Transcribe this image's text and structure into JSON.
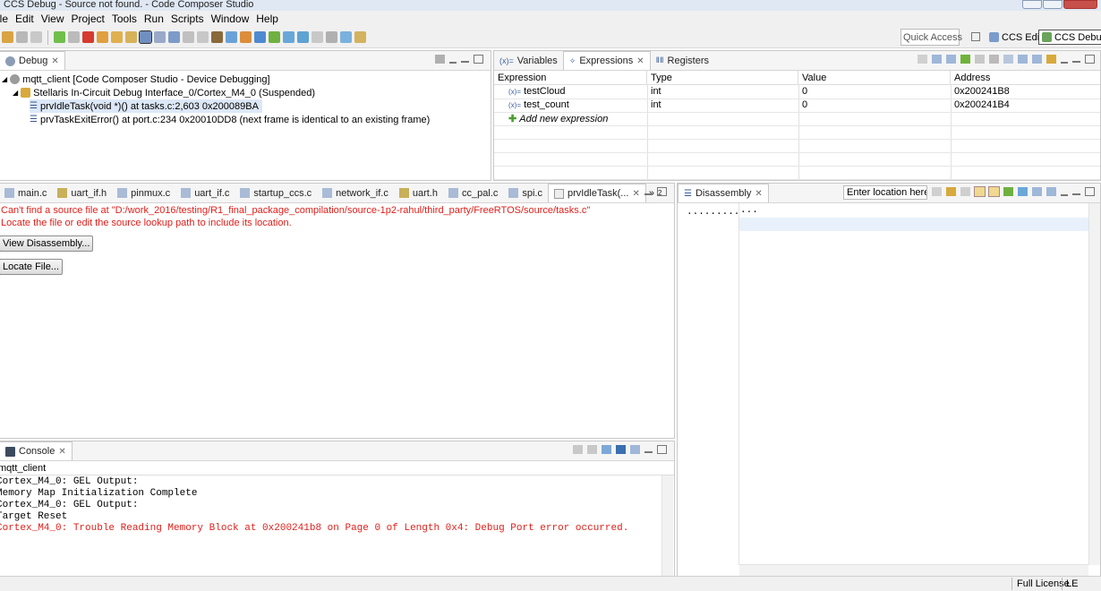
{
  "window": {
    "title": "CCS Debug - Source not found. - Code Composer Studio"
  },
  "menu": [
    "ile",
    "Edit",
    "View",
    "Project",
    "Tools",
    "Run",
    "Scripts",
    "Window",
    "Help"
  ],
  "toolbar": {
    "quick_access": "Quick Access",
    "perspectives": [
      {
        "label": "CCS Edit",
        "active": false
      },
      {
        "label": "CCS Debug",
        "active": true
      }
    ]
  },
  "debug_view": {
    "tab": "Debug",
    "tree": [
      {
        "label": "mqtt_client [Code Composer Studio - Device Debugging]",
        "icon": "debug-session-icon"
      },
      {
        "label": "Stellaris In-Circuit Debug Interface_0/Cortex_M4_0 (Suspended)",
        "icon": "thread-icon"
      },
      {
        "label": "prvIdleTask(void *)() at tasks.c:2,603 0x200089BA",
        "icon": "stack-frame-icon",
        "selected": true
      },
      {
        "label": "prvTaskExitError() at port.c:234 0x20010DD8  (next frame is identical to an existing frame)",
        "icon": "stack-frame-icon"
      }
    ]
  },
  "expressions_view": {
    "tabs": [
      "Variables",
      "Expressions",
      "Registers"
    ],
    "columns": [
      "Expression",
      "Type",
      "Value",
      "Address"
    ],
    "rows": [
      {
        "expression": "testCloud",
        "type": "int",
        "value": "0",
        "address": "0x200241B8"
      },
      {
        "expression": "test_count",
        "type": "int",
        "value": "0",
        "address": "0x200241B4"
      }
    ],
    "add_new": "Add new expression"
  },
  "editor": {
    "tabs": [
      "main.c",
      "uart_if.h",
      "pinmux.c",
      "uart_if.c",
      "startup_ccs.c",
      "network_if.c",
      "uart.h",
      "cc_pal.c",
      "spi.c",
      "prvIdleTask(..."
    ],
    "overflow": "»",
    "overflow_count": "2",
    "message_line1": "Can't find a source file at \"D:/work_2016/testing/R1_final_package_compilation/source-1p2-rahul/third_party/FreeRTOS/source/tasks.c\"",
    "message_line2": "Locate the file or edit the source lookup path to include its location.",
    "view_disassembly_btn": "View Disassembly...",
    "locate_file_btn": "Locate File..."
  },
  "disassembly": {
    "tab": "Disassembly",
    "location_placeholder": "Enter location here",
    "line_addr": ".........",
    "line_code": "..."
  },
  "console": {
    "tab": "Console",
    "process": "mqtt_client",
    "lines": [
      {
        "text": "Cortex_M4_0: GEL Output:",
        "error": false
      },
      {
        "text": "Memory Map Initialization Complete",
        "error": false
      },
      {
        "text": "Cortex_M4_0: GEL Output:",
        "error": false
      },
      {
        "text": "Target Reset",
        "error": false
      },
      {
        "text": "Cortex_M4_0: Trouble Reading Memory Block at 0x200241b8 on Page 0 of Length 0x4: Debug Port error occurred.",
        "error": true
      }
    ]
  },
  "statusbar": {
    "license": "Full License",
    "endian": "LE"
  },
  "colors": {
    "error_red": "#e0201b",
    "selection": "#dde8f7",
    "panel_bg": "#f0f0f0"
  }
}
